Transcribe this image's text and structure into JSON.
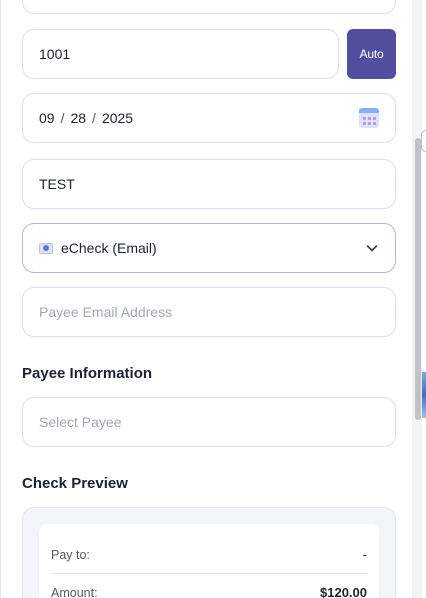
{
  "form": {
    "check_number": "1001",
    "auto_label": "Auto",
    "date": {
      "month": "09",
      "day": "28",
      "year": "2025",
      "separator": "/"
    },
    "memo": "TEST",
    "payment_method": "eCheck (Email)",
    "payee_email_placeholder": "Payee Email Address"
  },
  "payee": {
    "title": "Payee Information",
    "select_placeholder": "Select Payee"
  },
  "preview": {
    "title": "Check Preview",
    "pay_to_label": "Pay to:",
    "pay_to_value": "-",
    "amount_label": "Amount:",
    "amount_value": "$120.00"
  },
  "colors": {
    "accent": "#514e9d",
    "focus_border": "#b6b2e0"
  },
  "icons": [
    "calendar-icon",
    "echeck-icon",
    "chevron-down-icon"
  ]
}
